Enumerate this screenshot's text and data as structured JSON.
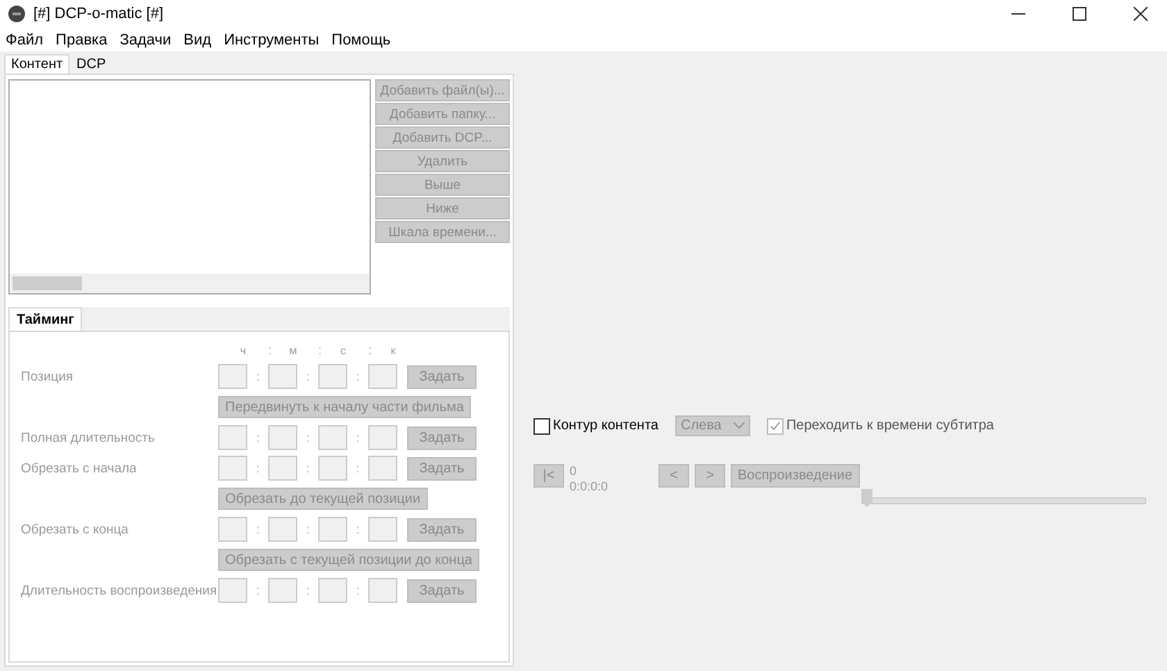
{
  "window": {
    "title": "[#] DCP-o-matic [#]"
  },
  "menu": [
    "Файл",
    "Правка",
    "Задачи",
    "Вид",
    "Инструменты",
    "Помощь"
  ],
  "tabs": [
    {
      "label": "Контент",
      "selected": true
    },
    {
      "label": "DCP",
      "selected": false
    }
  ],
  "content_buttons": [
    {
      "label": "Добавить файл(ы)...",
      "disabled": true
    },
    {
      "label": "Добавить папку...",
      "disabled": true
    },
    {
      "label": "Добавить DCP...",
      "disabled": true
    },
    {
      "label": "Удалить",
      "disabled": true
    },
    {
      "label": "Выше",
      "disabled": true
    },
    {
      "label": "Ниже",
      "disabled": true
    },
    {
      "label": "Шкала времени...",
      "disabled": true
    }
  ],
  "timing": {
    "tabs": [
      {
        "label": "Тайминг",
        "selected": true
      }
    ],
    "units": [
      "ч",
      "м",
      "с",
      "к"
    ],
    "separator": ":",
    "rows": [
      {
        "kind": "time",
        "label": "Позиция",
        "button": "Задать"
      },
      {
        "kind": "action",
        "button": "Передвинуть к началу части фильма"
      },
      {
        "kind": "time",
        "label": "Полная длительность",
        "button": "Задать"
      },
      {
        "kind": "time",
        "label": "Обрезать с начала",
        "button": "Задать"
      },
      {
        "kind": "action",
        "button": "Обрезать до текущей позиции"
      },
      {
        "kind": "time",
        "label": "Обрезать с конца",
        "button": "Задать"
      },
      {
        "kind": "action",
        "button": "Обрезать с текущей позиции до конца"
      },
      {
        "kind": "time",
        "label": "Длительность воспроизведения",
        "button": "Задать"
      }
    ]
  },
  "viewer": {
    "options": [
      {
        "kind": "checkbox",
        "label": "Контур контента",
        "checked": false,
        "disabled": false
      },
      {
        "kind": "dropdown",
        "value": "Слева"
      },
      {
        "kind": "checkbox",
        "label": "Переходить к времени субтитра",
        "checked": true,
        "disabled": true
      }
    ],
    "start_button": "|<",
    "frame": "0",
    "timecode": "0:0:0:0",
    "prev_button": "<",
    "next_button": ">",
    "play_button": "Воспроизведение",
    "position": {
      "level": 0
    }
  }
}
